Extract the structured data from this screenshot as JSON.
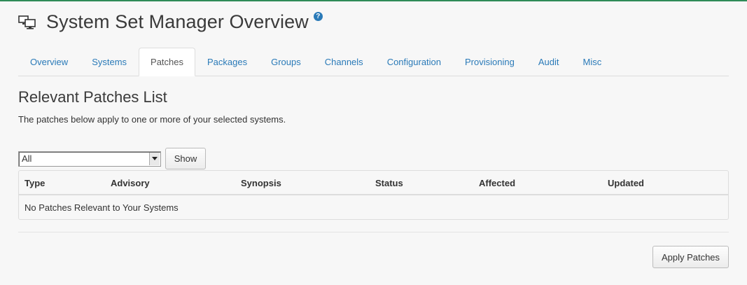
{
  "header": {
    "title": "System Set Manager Overview",
    "icon": "desktop-systems-icon",
    "help_icon": "?"
  },
  "tabs": [
    {
      "label": "Overview"
    },
    {
      "label": "Systems"
    },
    {
      "label": "Patches",
      "active": true
    },
    {
      "label": "Packages"
    },
    {
      "label": "Groups"
    },
    {
      "label": "Channels"
    },
    {
      "label": "Configuration"
    },
    {
      "label": "Provisioning"
    },
    {
      "label": "Audit"
    },
    {
      "label": "Misc"
    }
  ],
  "main": {
    "section_title": "Relevant Patches List",
    "description": "The patches below apply to one or more of your selected systems.",
    "filter": {
      "selected": "All",
      "show_label": "Show"
    },
    "table": {
      "columns": [
        "Type",
        "Advisory",
        "Synopsis",
        "Status",
        "Affected",
        "Updated"
      ],
      "empty_message": "No Patches Relevant to Your Systems"
    },
    "apply_label": "Apply Patches"
  },
  "colors": {
    "accent": "#2a7ab8",
    "top_border": "#2e8b57"
  }
}
